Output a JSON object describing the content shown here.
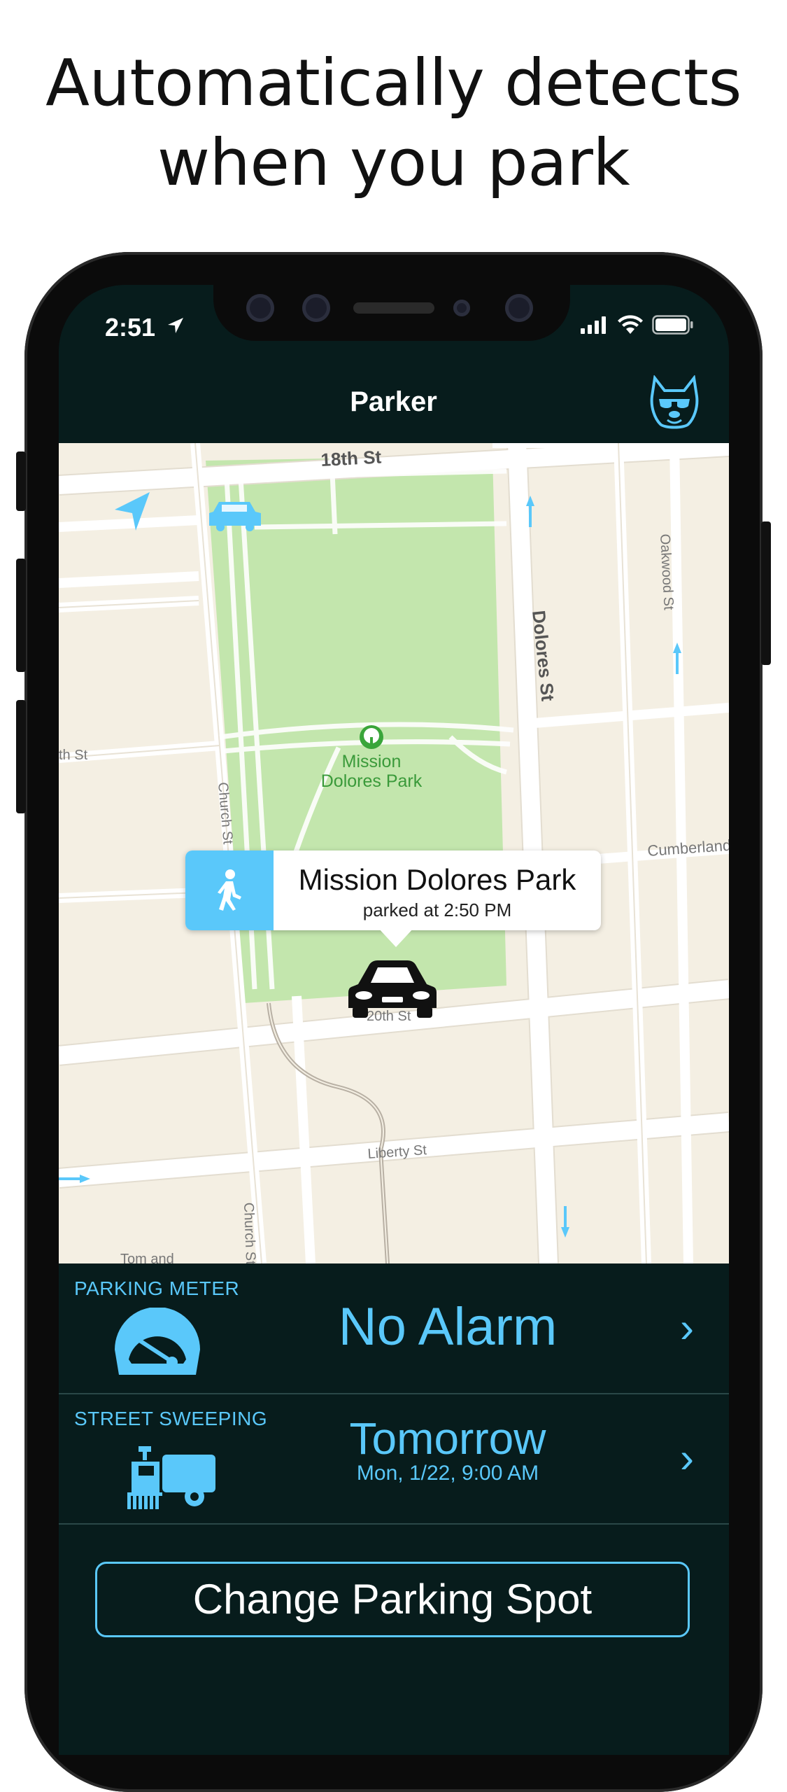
{
  "headline": {
    "line1": "Automatically detects",
    "line2": "when you park"
  },
  "status_bar": {
    "time": "2:51"
  },
  "nav": {
    "title": "Parker",
    "icon": "bulldog-icon"
  },
  "map": {
    "streets": [
      "18th St",
      "Dolores St",
      "Oakwood St",
      "Church St",
      "Cumberland",
      "Liberty St",
      "20th St",
      "Tom and",
      "th St"
    ],
    "poi_label_line1": "Mission",
    "poi_label_line2": "Dolores Park"
  },
  "callout": {
    "title": "Mission Dolores Park",
    "subtitle": "parked at 2:50 PM"
  },
  "parking_meter": {
    "label": "PARKING METER",
    "value": "No Alarm"
  },
  "street_sweeping": {
    "label": "STREET SWEEPING",
    "value": "Tomorrow",
    "detail": "Mon, 1/22, 9:00 AM"
  },
  "action": {
    "change_label": "Change Parking Spot"
  },
  "colors": {
    "accent": "#5ac8fa",
    "panel_bg": "#071c1c",
    "park_green": "#c3e6ad",
    "map_bg": "#f4efe3"
  }
}
